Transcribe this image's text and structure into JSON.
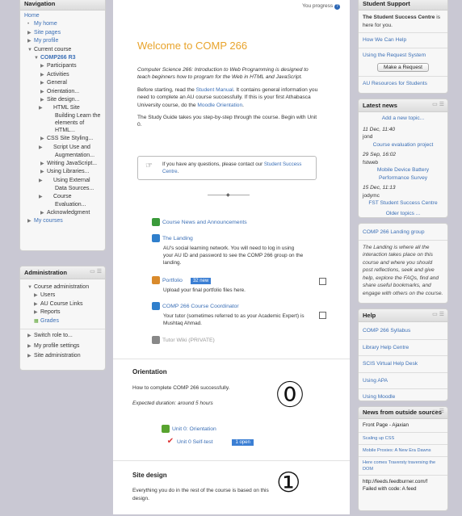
{
  "left_col": {
    "navigation": {
      "title": "Navigation",
      "home": "Home",
      "items": [
        {
          "label": "My home",
          "lvl": 1,
          "tri": "•"
        },
        {
          "label": "Site pages",
          "lvl": 1,
          "tri": "▶"
        },
        {
          "label": "My profile",
          "lvl": 1,
          "tri": "▶"
        },
        {
          "label": "Current course",
          "lvl": 1,
          "tri": "▼"
        },
        {
          "label": "COMP266 R3",
          "lvl": 2,
          "tri": "▼",
          "bold": true
        },
        {
          "label": "Participants",
          "lvl": 3,
          "tri": "▶"
        },
        {
          "label": "Activities",
          "lvl": 3,
          "tri": "▶"
        },
        {
          "label": "General",
          "lvl": 3,
          "tri": "▶"
        },
        {
          "label": "Orientation...",
          "lvl": 3,
          "tri": "▶"
        },
        {
          "label": "Site design...",
          "lvl": 3,
          "tri": "▶"
        },
        {
          "label": "HTML Site Building Learn the elements of HTML...",
          "lvl": 3,
          "tri": "▶",
          "wrap": true
        },
        {
          "label": "CSS Site Styling...",
          "lvl": 3,
          "tri": "▶"
        },
        {
          "label": "Script Use and Augmentation...",
          "lvl": 3,
          "tri": "▶",
          "wrap": true
        },
        {
          "label": "Writing JavaScript...",
          "lvl": 3,
          "tri": "▶"
        },
        {
          "label": "Using Libraries...",
          "lvl": 3,
          "tri": "▶"
        },
        {
          "label": "Using External Data Sources...",
          "lvl": 3,
          "tri": "▶",
          "wrap": true
        },
        {
          "label": "Course Evaluation...",
          "lvl": 3,
          "tri": "▶",
          "wrap": true
        },
        {
          "label": "Acknowledgment",
          "lvl": 3,
          "tri": "▶"
        },
        {
          "label": "My courses",
          "lvl": 1,
          "tri": "▶"
        }
      ]
    },
    "administration": {
      "title": "Administration",
      "items": [
        {
          "label": "Course administration",
          "lvl": 1,
          "tri": "▼"
        },
        {
          "label": "Users",
          "lvl": 2,
          "tri": "▶"
        },
        {
          "label": "AU Course Links",
          "lvl": 2,
          "tri": "▶"
        },
        {
          "label": "Reports",
          "lvl": 2,
          "tri": "▶"
        },
        {
          "label": "Grades",
          "lvl": 2,
          "tri": "▦"
        }
      ],
      "bottom_items": [
        "Switch role to...",
        "My profile settings",
        "Site administration"
      ]
    }
  },
  "main": {
    "top_right": "You progress",
    "title": "Welcome to COMP 266",
    "intro": "Computer Science 266: Introduction to Web Programming is designed to teach beginners how to program for the Web in HTML and JavaScript.",
    "p2_a": "Before starting, read the ",
    "p2_link1": "Student Manual",
    "p2_b": ". It contains general information you need to complete an AU course successfully. If this is your first Athabasca University course, do the ",
    "p2_link2": "Moodle Orientation",
    "p2_c": ".",
    "p3": "The Study Guide takes you step-by-step through the course. Begin with Unit 0.",
    "notice_a": "If you have any questions, please contact our ",
    "notice_link": "Student Success Centre",
    "notice_b": ".",
    "activities": [
      {
        "label": "Course News and Announcements",
        "desc": ""
      },
      {
        "label": "The Landing",
        "desc": "AU's social learning network. You will need to log in using your AU ID and password to see the COMP 266 group on the landing."
      },
      {
        "label": "Portfolio",
        "badge": "32 new",
        "desc": "Upload your final portfolio files here."
      },
      {
        "label": "COMP 266 Course Coordinator",
        "desc": "Your tutor (sometimes referred to as your Academic Expert) is Mushtaq Ahmad."
      },
      {
        "label": "Tutor Wiki (PRIVATE)",
        "desc": ""
      }
    ],
    "orientation": {
      "title": "Orientation",
      "desc": "How to complete COMP 266 successfully.",
      "duration": "Expected duration: around 5 hours",
      "number": "⓪",
      "unit": "Unit 0: Orientation",
      "selftest": "Unit 0 Self-test",
      "selftest_badge": "1 open"
    },
    "site_design": {
      "title": "Site design",
      "desc": "Everything you do in the rest of the course is based on this design.",
      "number": "①"
    }
  },
  "right_col": {
    "student_support": {
      "title": "Student Support",
      "intro_bold": "The Student Success Centre",
      "intro_rest": " is here for you.",
      "links": [
        "How We Can Help",
        "Using the Request System"
      ],
      "button": "Make a Request",
      "link_bottom": "AU Resources for Students"
    },
    "latest_news": {
      "title": "Latest news",
      "add": "Add a new topic...",
      "items": [
        {
          "date": "11 Dec, 11:40",
          "who": "jond",
          "topic": "Course evaluation project"
        },
        {
          "date": "29 Sep, 16:02",
          "who": "fstweb",
          "topic": "Mobile Device Battery Performance Survey"
        },
        {
          "date": "15 Dec, 11:13",
          "who": "jodymc",
          "topic": "FST Student Success Centre"
        }
      ],
      "older": "Older topics ..."
    },
    "landing_group": {
      "title": "COMP 266 Landing group",
      "text": "The Landing is where all the interaction takes place on this course and where you should post reflections, seek and give help, explore the FAQs, find and share useful bookmarks, and engage with others on the course."
    },
    "help": {
      "title": "Help",
      "links": [
        "COMP 266 Syllabus",
        "Library Help Centre",
        "SCIS Virtual Help Desk",
        "Using APA",
        "Using Moodle"
      ]
    },
    "outside_news": {
      "title": "News from outside sources",
      "source": "Front Page - Ajaxian",
      "items": [
        "Scaling up CSS",
        "Mobile Proxies: A New Era Dawns",
        "Here comes Traversty traversing the DOM"
      ],
      "feed": "http://feeds.feedburner.com/f",
      "failed": "Failed with code: A feed"
    }
  },
  "colors": {
    "accent_title": "#e8a32b",
    "link": "#3b6fb6",
    "badge": "#3b7fd4"
  }
}
